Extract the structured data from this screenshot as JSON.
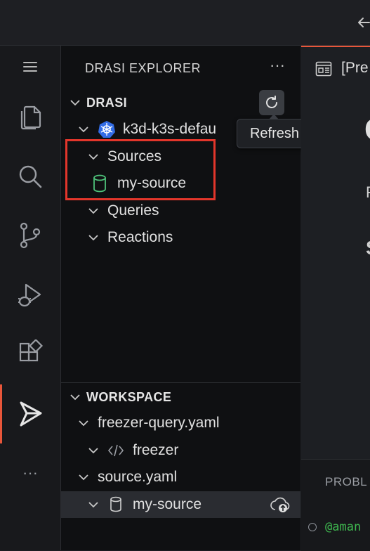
{
  "explorer": {
    "title": "DRASI EXPLORER",
    "more_label": "···",
    "drasi_section": "DRASI",
    "cluster_name": "k3d-k3s-defau",
    "tooltip": "Refresh",
    "tree": {
      "sources_label": "Sources",
      "source_item": "my-source",
      "queries_label": "Queries",
      "reactions_label": "Reactions"
    }
  },
  "workspace": {
    "title": "WORKSPACE",
    "files": [
      {
        "name": "freezer-query.yaml",
        "child": "freezer"
      },
      {
        "name": "source.yaml",
        "child": "my-source"
      }
    ]
  },
  "activity_bar": {
    "items": [
      "menu-icon",
      "explorer-icon",
      "search-icon",
      "source-control-icon",
      "run-debug-icon",
      "extensions-icon",
      "drasi-icon",
      "more-icon"
    ],
    "more_label": "···"
  },
  "editor": {
    "tab_label": "[Pre",
    "heading_char": "C",
    "line_char_1": "F",
    "line_char_2": "S",
    "panel_tab": "PROBL",
    "terminal_text": "@aman"
  },
  "colors": {
    "accent": "#e8563a",
    "highlight_box": "#e3362b",
    "database_icon": "#4ec27a",
    "kubernetes": "#326ce5",
    "terminal_user": "#3fb950"
  }
}
